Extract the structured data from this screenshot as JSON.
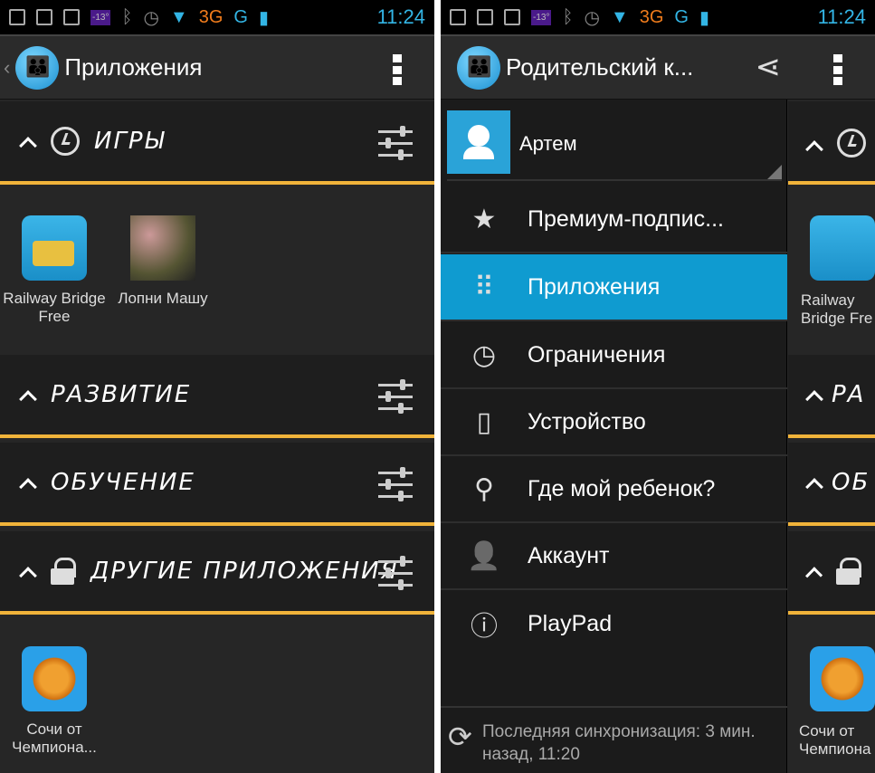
{
  "status_bar": {
    "temperature": "-13°",
    "network1": "3G",
    "network2": "G",
    "sim1": "1",
    "sim2": "2",
    "time": "11:24"
  },
  "left": {
    "title": "Приложения",
    "sections": [
      {
        "label": "ИГРЫ",
        "icon": "clock-icon",
        "apps": [
          {
            "label": "Railway Bridge Free"
          },
          {
            "label": "Лопни Машу"
          }
        ]
      },
      {
        "label": "РАЗВИТИЕ",
        "icon": "",
        "apps": []
      },
      {
        "label": "ОБУЧЕНИЕ",
        "icon": "",
        "apps": []
      },
      {
        "label": "ДРУГИЕ ПРИЛОЖЕНИЯ",
        "icon": "lock-icon",
        "apps": [
          {
            "label": "Сочи от Чемпиона..."
          }
        ]
      }
    ]
  },
  "right": {
    "title": "Родительский к...",
    "user": "Артем",
    "menu": [
      {
        "label": "Премиум-подпис...",
        "icon": "star-icon",
        "glyph": "★"
      },
      {
        "label": "Приложения",
        "icon": "grid-icon",
        "glyph": "⠿",
        "active": true
      },
      {
        "label": "Ограничения",
        "icon": "clock-icon",
        "glyph": "◷"
      },
      {
        "label": "Устройство",
        "icon": "phone-icon",
        "glyph": "▯"
      },
      {
        "label": "Где мой ребенок?",
        "icon": "location-pin-icon",
        "glyph": "⚲"
      },
      {
        "label": "Аккаунт",
        "icon": "account-icon",
        "glyph": "👤"
      },
      {
        "label": "PlayPad",
        "icon": "info-icon",
        "glyph": "ⓘ"
      }
    ],
    "sync": "Последняя синхронизация: 3 мин. назад, 11:20",
    "peek": {
      "app1": "Railway Bridge Fre",
      "app2": "Сочи от Чемпиона",
      "sec2": "РА",
      "sec3": "ОБ"
    }
  },
  "colors": {
    "accent": "#0f9bd0",
    "divider": "#f0b33a",
    "status_blue": "#33b5e5",
    "status_orange": "#f07c1c"
  }
}
